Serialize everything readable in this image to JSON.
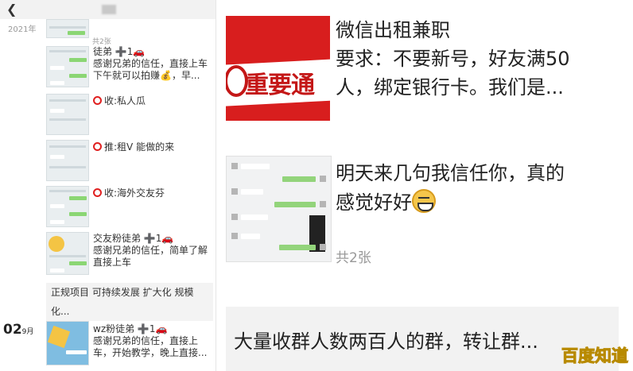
{
  "left": {
    "year": "2021年",
    "posts": [
      {
        "sub": "共2张"
      },
      {
        "line1": "徒弟 ➕1🚗",
        "line2": "感谢兄弟的信任，直接上车",
        "line3": "下午就可以拍赚💰，早..."
      },
      {
        "text": "收:私人瓜"
      },
      {
        "text": "推:租V 能做的来"
      },
      {
        "text": "收:海外交友芬"
      },
      {
        "line1": "交友粉徒弟 ➕1🚗",
        "line2": "感谢兄弟的信任，简单了解",
        "line3": "直接上车"
      },
      {
        "card": "正规项目 可持续发展 扩大化 规模化..."
      },
      {
        "date_day": "02",
        "date_month": "9月",
        "line1": "wz粉徒弟 ➕1🚗",
        "line2": "感谢兄弟的信任，直接上",
        "line3": "车，开始教学，晚上直接..."
      }
    ]
  },
  "right": {
    "red_card_word": "重要通",
    "post1": {
      "line1": "微信出租兼职",
      "line2": "要求：不要新号，好友满50",
      "line3": "人，绑定银行卡。我们是..."
    },
    "post2": {
      "line1": "明天来几句我信任你，真的",
      "line2": "感觉好好",
      "count": "共2张"
    },
    "post3": {
      "text": "大量收群人数两百人的群，转让群..."
    },
    "watermark": "百度知道"
  }
}
